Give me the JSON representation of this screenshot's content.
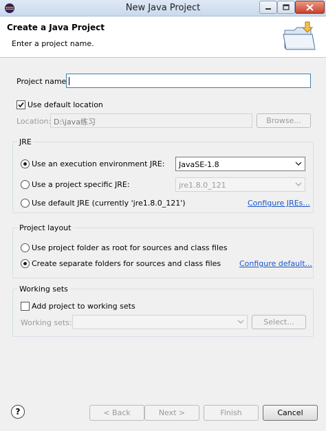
{
  "window": {
    "title": "New Java Project",
    "icons": [
      "eclipse-icon",
      "minimize-icon",
      "maximize-icon",
      "close-icon"
    ]
  },
  "header": {
    "title": "Create a Java Project",
    "message": "Enter a project name.",
    "banner_icon": "new-java-project-wizard-icon"
  },
  "project_name": {
    "label": "Project name:",
    "value": ""
  },
  "location": {
    "use_default_label": "Use default location",
    "use_default_checked": true,
    "label": "Location:",
    "value": "D:\\java练习",
    "browse_label": "Browse..."
  },
  "jre": {
    "group_label": "JRE",
    "option_env_label": "Use an execution environment JRE:",
    "env_value": "JavaSE-1.8",
    "option_specific_label": "Use a project specific JRE:",
    "specific_value": "jre1.8.0_121",
    "option_default_label": "Use default JRE (currently 'jre1.8.0_121')",
    "configure_link": "Configure JREs...",
    "selected": "env"
  },
  "layout": {
    "group_label": "Project layout",
    "option_root_label": "Use project folder as root for sources and class files",
    "option_separate_label": "Create separate folders for sources and class files",
    "configure_link": "Configure default...",
    "selected": "separate"
  },
  "working_sets": {
    "group_label": "Working sets",
    "add_label": "Add project to working sets",
    "add_checked": false,
    "sets_label": "Working sets:",
    "select_label": "Select..."
  },
  "footer": {
    "help_symbol": "?",
    "back_label": "< Back",
    "next_label": "Next >",
    "finish_label": "Finish",
    "cancel_label": "Cancel"
  }
}
